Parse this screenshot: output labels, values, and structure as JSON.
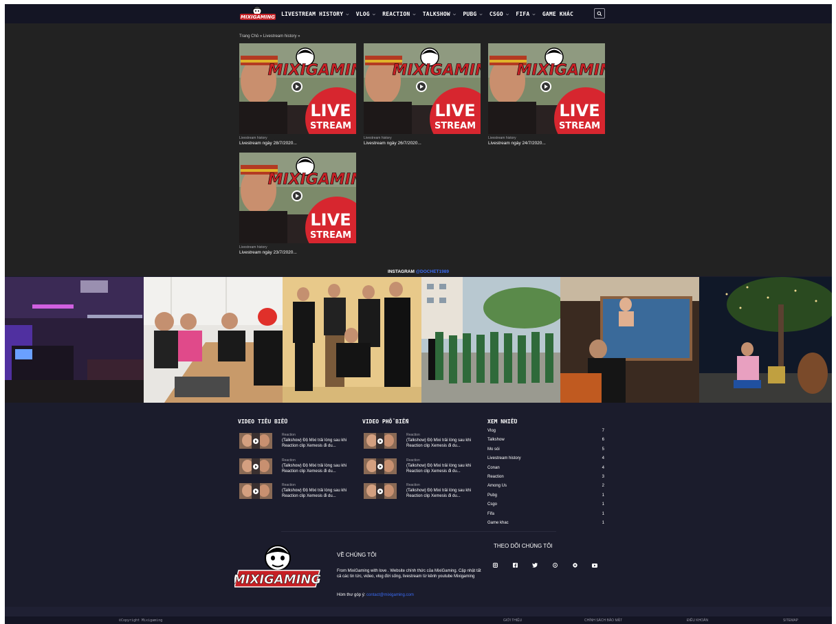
{
  "nav": {
    "logo_text": "MIXIGAMING",
    "items": [
      {
        "label": "LIVESTREAM HISTORY",
        "has_dropdown": true
      },
      {
        "label": "VLOG",
        "has_dropdown": true
      },
      {
        "label": "REACTION",
        "has_dropdown": true
      },
      {
        "label": "TALKSHOW",
        "has_dropdown": true
      },
      {
        "label": "PUBG",
        "has_dropdown": true
      },
      {
        "label": "CSGO",
        "has_dropdown": true
      },
      {
        "label": "FIFA",
        "has_dropdown": true
      },
      {
        "label": "GAME KHÁC",
        "has_dropdown": false
      }
    ],
    "search_icon": "search-icon"
  },
  "breadcrumb": "Trang Chủ » Livestream history »",
  "posts": [
    {
      "category": "Livestream history",
      "title": "Livestream ngày 28/7/2020...",
      "thumb_text": "MIXIGAMING",
      "thumb_live": "LIVE",
      "thumb_stream": "STREAM"
    },
    {
      "category": "Livestream history",
      "title": "Livestream ngày 26/7/2020...",
      "thumb_text": "MIXIGAMING",
      "thumb_live": "LIVE",
      "thumb_stream": "STREAM"
    },
    {
      "category": "Livestream history",
      "title": "Livestream ngày 24/7/2020...",
      "thumb_text": "MIXIGAMING",
      "thumb_live": "LIVE",
      "thumb_stream": "STREAM"
    },
    {
      "category": "Livestream history",
      "title": "Livestream ngày 23/7/2020...",
      "thumb_text": "MIXIGAMING",
      "thumb_live": "LIVE",
      "thumb_stream": "STREAM"
    }
  ],
  "instagram": {
    "label": "INSTAGRAM",
    "handle": "@DOCHET1989"
  },
  "featured": {
    "title": "VIDEO TIÊU BIỂU",
    "items": [
      {
        "category": "Reaction",
        "title": "(Talkshow) Độ Mixi trải lòng sau khi Reaction clip Xemesis đi du..."
      },
      {
        "category": "Reaction",
        "title": "(Talkshow) Độ Mixi trải lòng sau khi Reaction clip Xemesis đi du..."
      },
      {
        "category": "Reaction",
        "title": "(Talkshow) Độ Mixi trải lòng sau khi Reaction clip Xemesis đi du..."
      }
    ]
  },
  "popular": {
    "title": "VIDEO PHỔ BIẾN",
    "items": [
      {
        "category": "Reaction",
        "title": "(Talkshow) Độ Mixi trải lòng sau khi Reaction clip Xemesis đi du..."
      },
      {
        "category": "Reaction",
        "title": "(Talkshow) Độ Mixi trải lòng sau khi Reaction clip Xemesis đi du..."
      },
      {
        "category": "Reaction",
        "title": "(Talkshow) Độ Mixi trải lòng sau khi Reaction clip Xemesis đi du..."
      }
    ]
  },
  "most_viewed": {
    "title": "XEM NHIỀU",
    "items": [
      {
        "name": "Vlog",
        "count": "7"
      },
      {
        "name": "Talkshow",
        "count": "6"
      },
      {
        "name": "Mo sói",
        "count": "5"
      },
      {
        "name": "Livestream history",
        "count": "4"
      },
      {
        "name": "Conan",
        "count": "4"
      },
      {
        "name": "Reaction",
        "count": "3"
      },
      {
        "name": "Among Us",
        "count": "2"
      },
      {
        "name": "Pubg",
        "count": "1"
      },
      {
        "name": "Csgo",
        "count": "1"
      },
      {
        "name": "Fifa",
        "count": "1"
      },
      {
        "name": "Game khac",
        "count": "1"
      }
    ]
  },
  "about": {
    "logo_text": "MIXIGAMING",
    "title": "VỀ CHÚNG TÔI",
    "text": "From MixiGaming with love . Website chính thức của MixiGaming. Cập nhật tất cả các tin tức, video, vlog đời sống, livestream từ kênh youtube Mixigaming",
    "mail_label": "Hòm thư góp ý:",
    "mail": "contact@mixigaming.com"
  },
  "follow": {
    "title": "THEO DÕI CHÚNG TÔI",
    "icons": [
      "instagram-icon",
      "facebook-icon",
      "twitter-icon",
      "threads-icon",
      "tiktok-icon",
      "youtube-icon"
    ]
  },
  "bottom": {
    "copyright": "©Copyright Mixigaming",
    "links": [
      "GIỚI THIỆU",
      "CHÍNH SÁCH BẢO MẬT",
      "ĐIỀU KHOẢN",
      "SITEMAP"
    ]
  },
  "colors": {
    "page_bg": "#1b1c2c",
    "nav_bg": "#141524",
    "content_bg": "#222222",
    "accent_blue": "#3a6cf6",
    "live_red": "#d7262f"
  }
}
